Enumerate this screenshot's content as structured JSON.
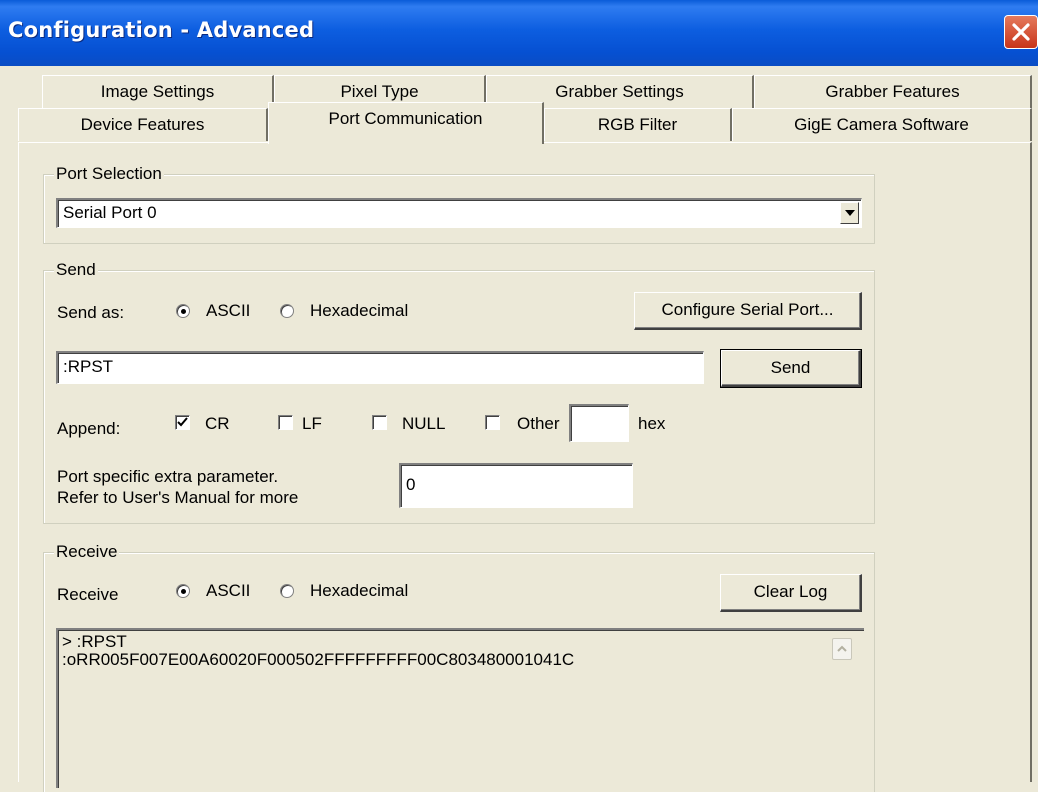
{
  "window": {
    "title": "Configuration - Advanced"
  },
  "tabs": {
    "row1": [
      "Image Settings",
      "Pixel Type",
      "Grabber Settings",
      "Grabber Features"
    ],
    "row2": [
      "Device Features",
      "Port Communication",
      "RGB Filter",
      "GigE Camera Software"
    ],
    "active": "Port Communication"
  },
  "port_selection": {
    "legend": "Port Selection",
    "selected": "Serial Port 0"
  },
  "send": {
    "legend": "Send",
    "send_as_label": "Send as:",
    "radio_ascii": "ASCII",
    "radio_hex": "Hexadecimal",
    "selected_format": "ASCII",
    "configure_button": "Configure Serial Port...",
    "input_value": ":RPST",
    "send_button": "Send",
    "append_label": "Append:",
    "append_cr": "CR",
    "append_lf": "LF",
    "append_null": "NULL",
    "append_other": "Other",
    "cr_checked": true,
    "lf_checked": false,
    "null_checked": false,
    "other_checked": false,
    "other_value": "",
    "hex_label": "hex",
    "extra_param_line1": "Port specific extra parameter.",
    "extra_param_line2": "Refer to User's Manual for more",
    "extra_param_value": "0"
  },
  "receive": {
    "legend": "Receive",
    "receive_label": "Receive",
    "radio_ascii": "ASCII",
    "radio_hex": "Hexadecimal",
    "selected_format": "ASCII",
    "clear_button": "Clear Log",
    "log_lines": [
      "> :RPST",
      ":oRR005F007E00A60020F000502FFFFFFFFF00C803480001041C"
    ]
  },
  "icons": {
    "close": "close-icon",
    "dropdown": "chevron-down-icon",
    "checkmark": "checkmark-icon",
    "scroll_up": "chevron-up-icon"
  },
  "colors": {
    "titlebar": "#0a5bd8",
    "dialog_bg": "#ece9d8",
    "close_button": "#c8341a"
  }
}
